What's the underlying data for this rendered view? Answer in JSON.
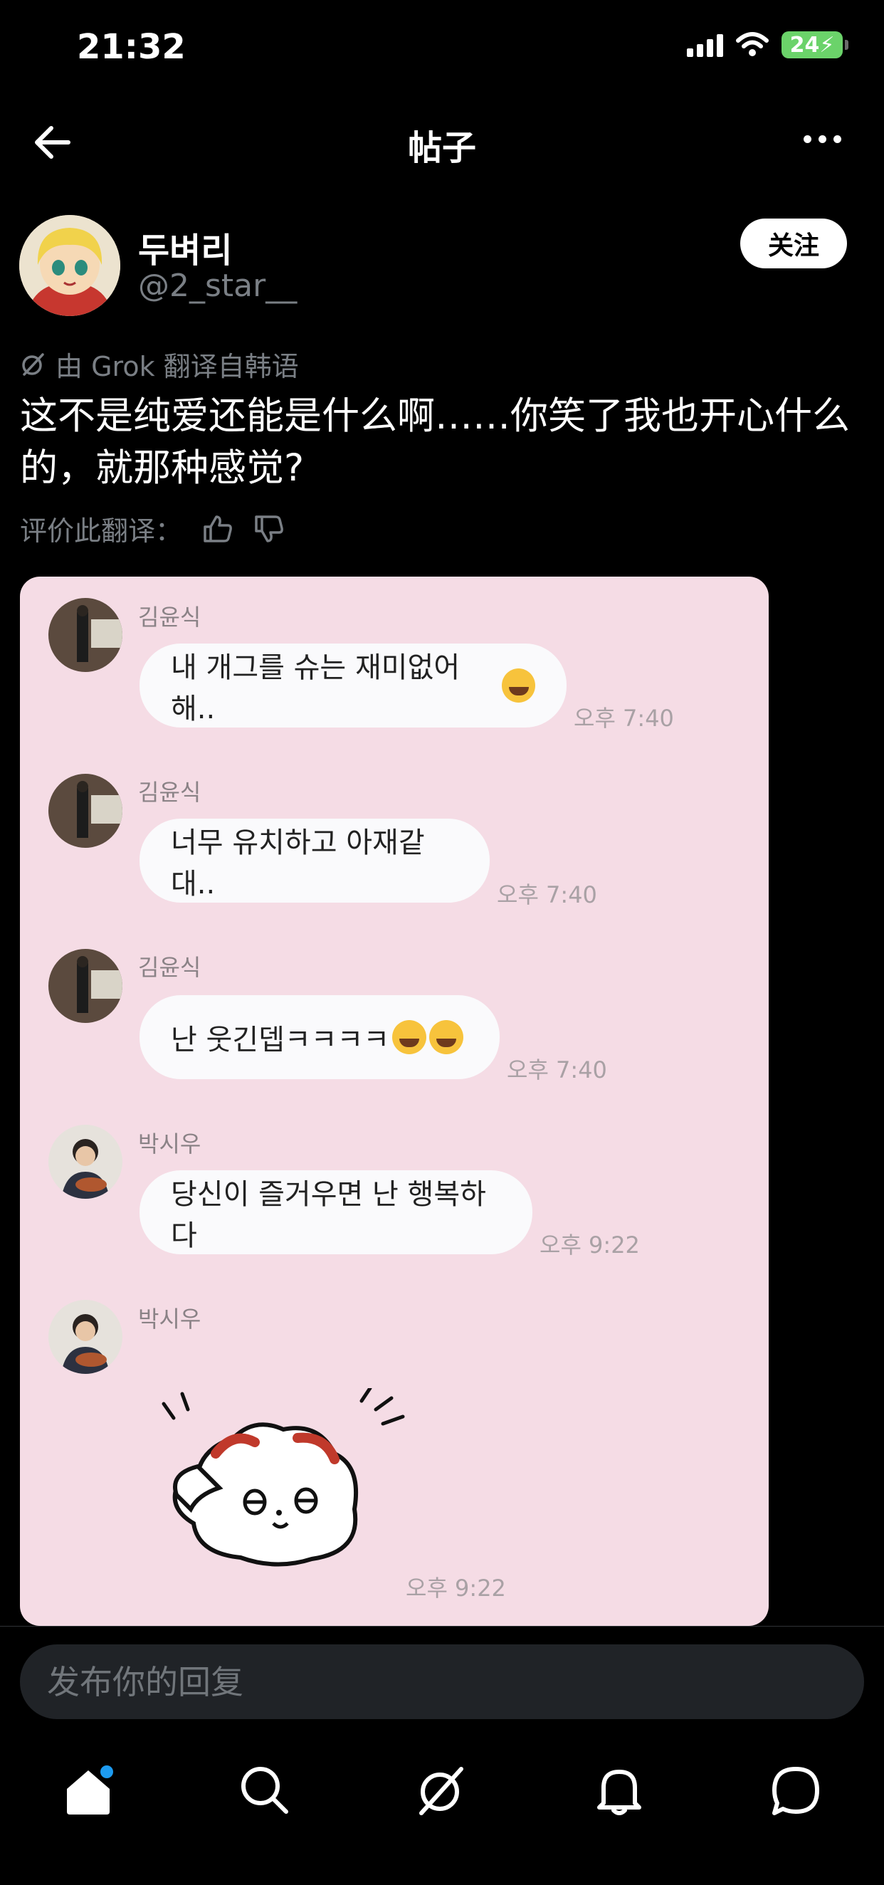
{
  "status_bar": {
    "time": "21:32",
    "battery": "24"
  },
  "nav": {
    "title": "帖子"
  },
  "post": {
    "author_name": "두벼리",
    "author_handle": "@2_star__",
    "follow_label": "关注",
    "translation_note": "由 Grok 翻译自韩语",
    "text": "这不是纯爱还能是什么啊……你笑了我也开心什么的，就那种感觉?",
    "rate_label": "评价此翻译："
  },
  "chat": {
    "messages": [
      {
        "sender": "김윤식",
        "text": "내 개그를 슈는 재미없어해..",
        "time": "오후 7:40"
      },
      {
        "sender": "김윤식",
        "text": "너무 유치하고 아재같대..",
        "time": "오후 7:40"
      },
      {
        "sender": "김윤식",
        "text": "난 웃긴뎁ㅋㅋㅋㅋ",
        "time": "오후 7:40"
      },
      {
        "sender": "박시우",
        "text": "당신이 즐거우면 난 행복하다",
        "time": "오후 9:22"
      },
      {
        "sender": "박시우",
        "text": "",
        "time": "오후 9:22"
      }
    ]
  },
  "reply": {
    "placeholder": "发布你的回复"
  },
  "icons": {
    "back": "arrow-left-icon",
    "more": "more-icon",
    "grok": "grok-icon",
    "thumbs_up": "thumbs-up-icon",
    "thumbs_down": "thumbs-down-icon",
    "home": "home-icon",
    "search": "search-icon",
    "grok_tab": "grok-icon",
    "notifications": "bell-icon",
    "messages": "chat-icon"
  },
  "colors": {
    "card_bg": "#f5dce5",
    "accent": "#1d9bf0",
    "follow_bg": "#ffffff"
  }
}
